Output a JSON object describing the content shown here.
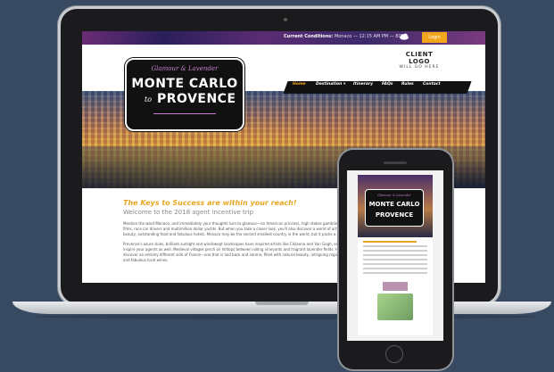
{
  "site": {
    "topbar": {
      "conditions_label": "Current Conditions:",
      "conditions_value": "Monaco — 12:15 AM PM — 80°F",
      "login_label": "Login"
    },
    "client_logo": {
      "line1": "CLIENT LOGO",
      "line2": "WILL GO HERE"
    },
    "nav": [
      {
        "label": "Home"
      },
      {
        "label": "Destination ▾"
      },
      {
        "label": "Itinerary"
      },
      {
        "label": "FAQs"
      },
      {
        "label": "Rules"
      },
      {
        "label": "Contact"
      }
    ],
    "badge": {
      "script": "Glamour & Lavender",
      "line1": "MONTE CARLO",
      "to": "to",
      "line2": "PROVENCE"
    },
    "content": {
      "headline": "The Keys to Success are within your reach!",
      "subhead": "Welcome to the 2018 agent incentive trip",
      "para1": "Mention the word Monaco, and immediately your thoughts turn to glamour—an American princess, high stakes gambling, James Bond films, race car drivers and multimillion dollar yachts. But when you take a closer look, you'll also discover a world of art, natural beauty, outstanding food and fabulous hotels. Monaco may be the second smallest country in the world, but it packs a punch.",
      "para2": "Provence's azure skies, brilliant sunlight and windswept landscapes have inspired artists like Cézanne and Van Gogh, and it will inspire your agents as well. Medieval villages perch on hilltops between rolling vineyards and fragrant lavender fields. Here they'll discover an entirely different side of France—one that is laid back and serene, filled with natural beauty, intriguing regional cuisine and fabulous local wines."
    }
  },
  "colors": {
    "accent": "#f3a51b",
    "background": "#374a62",
    "badge_purple": "#c77dd0"
  },
  "icons": {
    "weather": "cloud-icon"
  }
}
